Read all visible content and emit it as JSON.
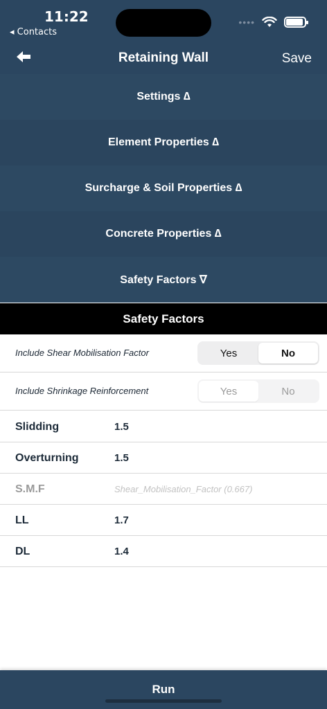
{
  "status_bar": {
    "time": "11:22",
    "back_app": "◂ Contacts",
    "signal_dots": "••••"
  },
  "nav": {
    "title": "Retaining Wall",
    "save_label": "Save"
  },
  "sections": [
    {
      "label": "Settings ∆"
    },
    {
      "label": "Element Properties ∆"
    },
    {
      "label": "Surcharge & Soil Properties ∆"
    },
    {
      "label": "Concrete Properties ∆"
    },
    {
      "label": "Safety Factors ∇"
    }
  ],
  "safety_header": "Safety Factors",
  "toggles": [
    {
      "label": "Include Shear Mobilisation Factor",
      "yes": "Yes",
      "no": "No",
      "selected": "No",
      "enabled": true
    },
    {
      "label": "Include Shrinkage Reinforcement",
      "yes": "Yes",
      "no": "No",
      "selected": "Yes",
      "enabled": false
    }
  ],
  "fields": [
    {
      "label": "Slidding",
      "value": "1.5"
    },
    {
      "label": "Overturning",
      "value": "1.5"
    },
    {
      "label": "S.M.F",
      "placeholder": "Shear_Mobilisation_Factor (0.667)"
    },
    {
      "label": "LL",
      "value": "1.7"
    },
    {
      "label": "DL",
      "value": "1.4"
    }
  ],
  "run_label": "Run",
  "colors": {
    "navy": "#2b4660",
    "header_black": "#000000"
  }
}
